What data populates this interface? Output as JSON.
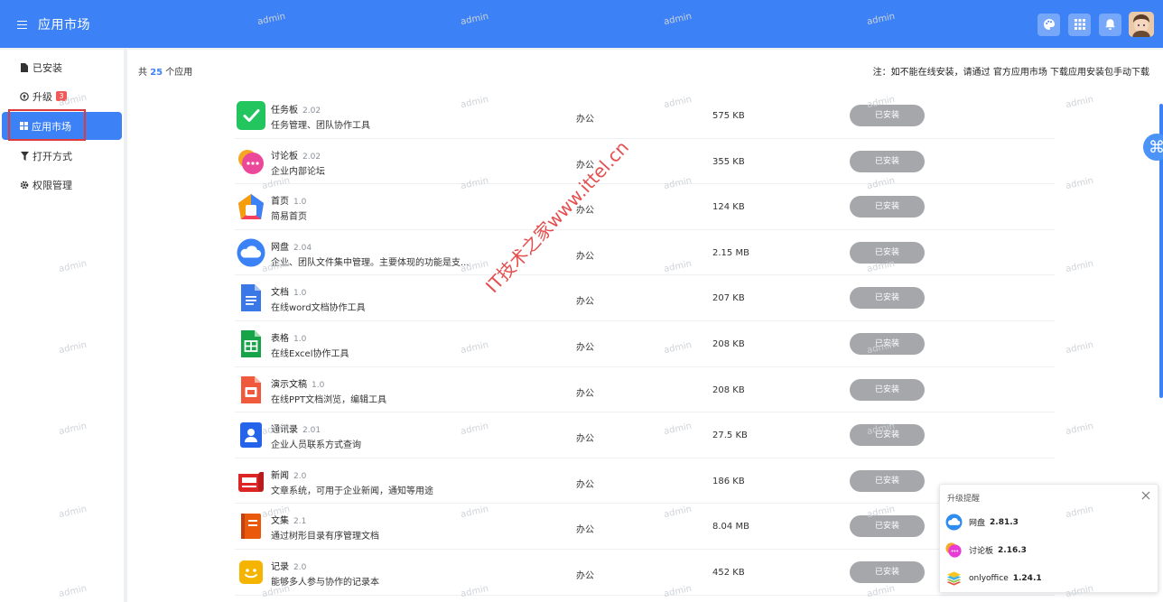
{
  "header": {
    "title": "应用市场",
    "menu_icon": "menu-icon",
    "actions": [
      "palette-icon",
      "grid-icon",
      "bell-icon"
    ]
  },
  "sidebar": {
    "items": [
      {
        "label": "已安装",
        "icon": "file-icon"
      },
      {
        "label": "升级",
        "icon": "upgrade-icon",
        "badge": "3"
      },
      {
        "label": "应用市场",
        "icon": "grid-icon",
        "active": true
      },
      {
        "label": "打开方式",
        "icon": "filter-icon"
      },
      {
        "label": "权限管理",
        "icon": "gear-icon"
      }
    ]
  },
  "summary": {
    "prefix": "共",
    "count": "25",
    "suffix": "个应用"
  },
  "note": "注：如不能在线安装，请通过 官方应用市场 下载应用安装包手动下载",
  "apps": [
    {
      "name": "任务板",
      "version": "2.02",
      "desc": "任务管理、团队协作工具",
      "category": "办公",
      "size": "575 KB",
      "status": "已安装",
      "icon": "task-board-icon",
      "color": "#22c55e"
    },
    {
      "name": "讨论板",
      "version": "2.02",
      "desc": "企业内部论坛",
      "category": "办公",
      "size": "355 KB",
      "status": "已安装",
      "icon": "discussion-icon",
      "color": "#ec4899"
    },
    {
      "name": "首页",
      "version": "1.0",
      "desc": "简易首页",
      "category": "办公",
      "size": "124 KB",
      "status": "已安装",
      "icon": "home-icon",
      "color": "#f59e0b"
    },
    {
      "name": "网盘",
      "version": "2.04",
      "desc": "企业、团队文件集中管理。主要体现的功能是支...",
      "category": "办公",
      "size": "2.15 MB",
      "status": "已安装",
      "icon": "cloud-drive-icon",
      "color": "#3b82f6"
    },
    {
      "name": "文档",
      "version": "1.0",
      "desc": "在线word文档协作工具",
      "category": "办公",
      "size": "207 KB",
      "status": "已安装",
      "icon": "doc-icon",
      "color": "#3b78e7"
    },
    {
      "name": "表格",
      "version": "1.0",
      "desc": "在线Excel协作工具",
      "category": "办公",
      "size": "208 KB",
      "status": "已安装",
      "icon": "sheet-icon",
      "color": "#16a34a"
    },
    {
      "name": "演示文稿",
      "version": "1.0",
      "desc": "在线PPT文档浏览，编辑工具",
      "category": "办公",
      "size": "208 KB",
      "status": "已安装",
      "icon": "slides-icon",
      "color": "#ef5a3c"
    },
    {
      "name": "通讯录",
      "version": "2.01",
      "desc": "企业人员联系方式查询",
      "category": "办公",
      "size": "27.5 KB",
      "status": "已安装",
      "icon": "contacts-icon",
      "color": "#2563eb"
    },
    {
      "name": "新闻",
      "version": "2.0",
      "desc": "文章系统，可用于企业新闻，通知等用途",
      "category": "办公",
      "size": "186 KB",
      "status": "已安装",
      "icon": "news-icon",
      "color": "#dc2626"
    },
    {
      "name": "文集",
      "version": "2.1",
      "desc": "通过树形目录有序管理文档",
      "category": "办公",
      "size": "8.04 MB",
      "status": "已安装",
      "icon": "notebook-icon",
      "color": "#ea580c"
    },
    {
      "name": "记录",
      "version": "2.0",
      "desc": "能够多人参与协作的记录本",
      "category": "办公",
      "size": "452 KB",
      "status": "已安装",
      "icon": "notes-icon",
      "color": "#f5b400"
    }
  ],
  "upgrade_popup": {
    "title": "升级提醒",
    "items": [
      {
        "name": "网盘",
        "version": "2.81.3",
        "icon": "cloud-drive-icon"
      },
      {
        "name": "讨论板",
        "version": "2.16.3",
        "icon": "discussion-icon"
      },
      {
        "name": "onlyoffice",
        "version": "1.24.1",
        "icon": "onlyoffice-icon"
      }
    ]
  },
  "watermarks": {
    "user": "admin",
    "site": "IT技术之家www.ittel.cn"
  }
}
